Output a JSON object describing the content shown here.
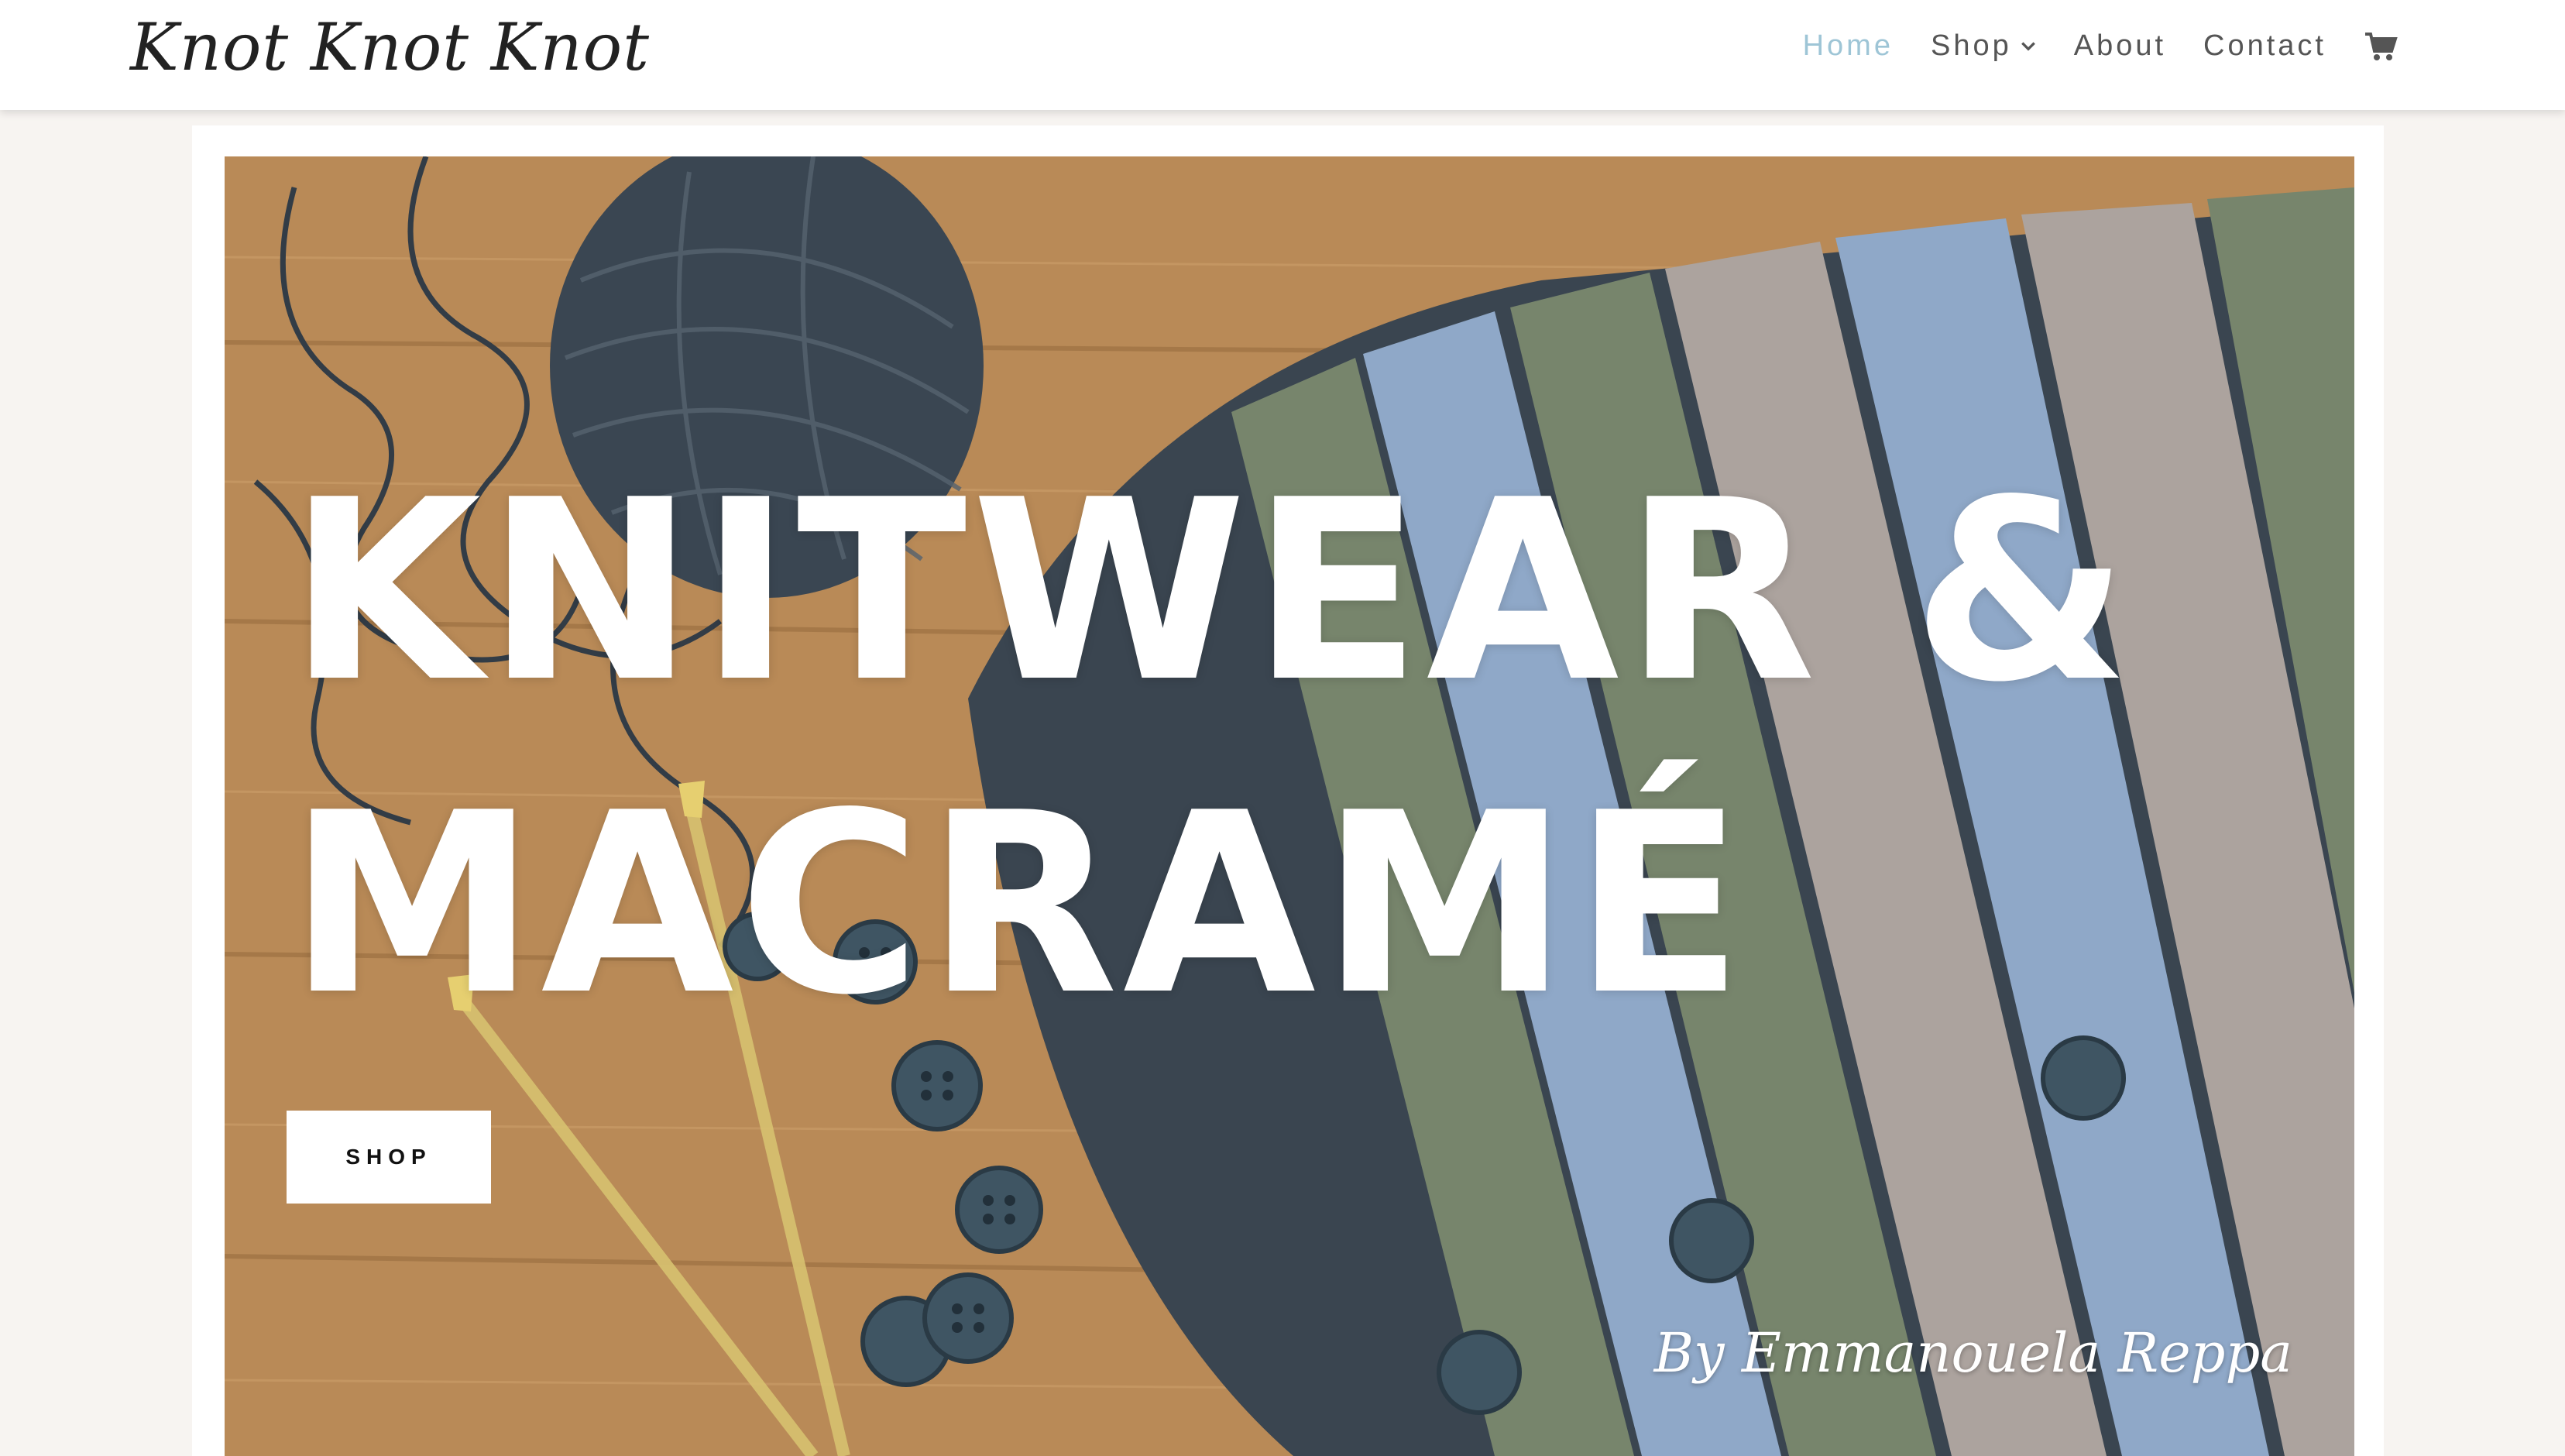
{
  "header": {
    "logo": "Knot Knot Knot",
    "nav": [
      {
        "label": "Home",
        "active": true
      },
      {
        "label": "Shop",
        "has_dropdown": true
      },
      {
        "label": "About"
      },
      {
        "label": "Contact"
      }
    ],
    "cart_icon": "cart-icon"
  },
  "hero": {
    "title_line1": "KNITWEAR &",
    "title_line2": "MACRAMÉ",
    "button_label": "SHOP",
    "signature": "By Emmanouela Reppa"
  },
  "colors": {
    "nav_active": "#9ec5d6",
    "nav_text": "#555555",
    "page_bg": "#f7f4f1",
    "wood": "#b98a57",
    "stripe_blue": "#8fa8c8",
    "stripe_green": "#77856c",
    "stripe_grey": "#aca39e",
    "stripe_dark": "#2f3a44"
  }
}
